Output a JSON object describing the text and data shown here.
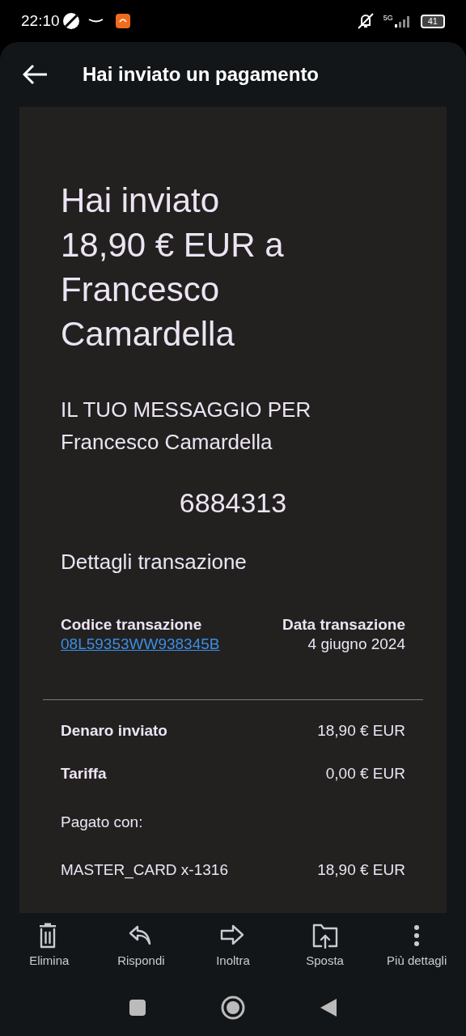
{
  "status_bar": {
    "time": "22:10",
    "network": "5G",
    "battery": "41"
  },
  "header": {
    "title": "Hai inviato un pagamento"
  },
  "email": {
    "headline": "Hai inviato 18,90 € EUR a Francesco Camardella",
    "message_label": "IL TUO MESSAGGIO PER",
    "message_sender": "Francesco Camardella",
    "message": "6884313",
    "details_title": "Dettagli transazione",
    "code_label": "Codice transazione",
    "code_value": "08L59353WW938345B",
    "date_label": "Data transazione",
    "date_value": "4 giugno 2024",
    "rows": [
      {
        "label": "Denaro inviato",
        "value": "18,90 € EUR",
        "bold": true
      },
      {
        "label": "Tariffa",
        "value": "0,00 € EUR",
        "bold": true
      },
      {
        "label": "Pagato con:",
        "bold": false
      },
      {
        "label": "MASTER_CARD x-1316",
        "value": "18,90 € EUR",
        "bold": false
      }
    ]
  },
  "toolbar": [
    {
      "label": "Elimina",
      "kind": "trash"
    },
    {
      "label": "Rispondi",
      "kind": "reply"
    },
    {
      "label": "Inoltra",
      "kind": "forward"
    },
    {
      "label": "Sposta",
      "kind": "move"
    },
    {
      "label": "Più dettagli",
      "kind": "more"
    }
  ]
}
